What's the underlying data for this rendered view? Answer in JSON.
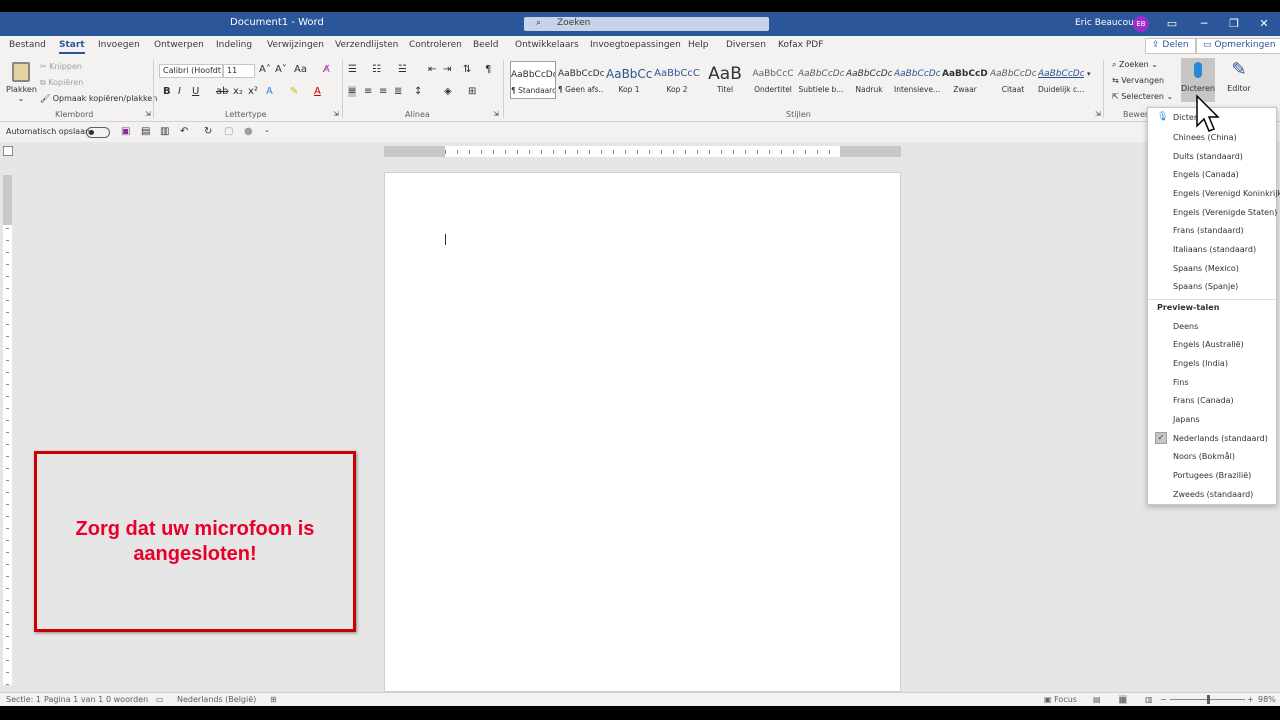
{
  "titlebar": {
    "title": "Document1  -  Word",
    "search_placeholder": "Zoeken",
    "user_name": "Eric Beaucourt",
    "user_initials": "EB",
    "min_glyph": "─",
    "max_glyph": "❐",
    "close_glyph": "✕"
  },
  "tabs": [
    "Bestand",
    "Start",
    "Invoegen",
    "Ontwerpen",
    "Indeling",
    "Verwijzingen",
    "Verzendlijsten",
    "Controleren",
    "Beeld",
    "Ontwikkelaars",
    "Invoegtoepassingen",
    "Help",
    "Diversen",
    "Kofax PDF"
  ],
  "tab_actions": {
    "share": "Delen",
    "comments": "Opmerkingen"
  },
  "ribbon": {
    "clipboard": {
      "paste": "Plakken",
      "cut": "Knippen",
      "copy": "Kopiëren",
      "format_painter": "Opmaak kopiëren/plakken",
      "label": "Klembord"
    },
    "font": {
      "font_name": "Calibri (Hoofdt",
      "font_size": "11",
      "label": "Lettertype"
    },
    "paragraph": {
      "label": "Alinea"
    },
    "styles": {
      "label": "Stijlen",
      "items": [
        {
          "preview": "AaBbCcDc",
          "name": "¶ Standaard"
        },
        {
          "preview": "AaBbCcDc",
          "name": "¶ Geen afs..."
        },
        {
          "preview": "AaBbCc",
          "name": "Kop 1"
        },
        {
          "preview": "AaBbCcC",
          "name": "Kop 2"
        },
        {
          "preview": "AaB",
          "name": "Titel"
        },
        {
          "preview": "AaBbCcC",
          "name": "Ondertitel"
        },
        {
          "preview": "AaBbCcDc",
          "name": "Subtiele b..."
        },
        {
          "preview": "AaBbCcDc",
          "name": "Nadruk"
        },
        {
          "preview": "AaBbCcDc",
          "name": "Intensieve..."
        },
        {
          "preview": "AaBbCcDc",
          "name": "Zwaar"
        },
        {
          "preview": "AaBbCcDc",
          "name": "Citaat"
        },
        {
          "preview": "AaBbCcDc",
          "name": "Duidelijk c..."
        }
      ]
    },
    "editing": {
      "find": "Zoeken",
      "replace": "Vervangen",
      "select": "Selecteren",
      "label": "Bewerk"
    },
    "dictate": "Dicteren",
    "editor": "Editor"
  },
  "qat": {
    "autosave": "Automatisch opslaan"
  },
  "callout": {
    "text": "Zorg dat uw microfoon is aangesloten!"
  },
  "dictate_menu": {
    "top_item": "Dicteren",
    "languages": [
      "Chinees (China)",
      "Duits (standaard)",
      "Engels (Canada)",
      "Engels (Verenigd Koninkrijk)",
      "Engels (Verenigde Staten)",
      "Frans (standaard)",
      "Italiaans (standaard)",
      "Spaans (Mexico)",
      "Spaans (Spanje)"
    ],
    "preview_heading": "Preview-talen",
    "preview_languages": [
      "Deens",
      "Engels (Australië)",
      "Engels (India)",
      "Fins",
      "Frans (Canada)",
      "Japans",
      "Nederlands (standaard)",
      "Noors (Bokmål)",
      "Portugees (Brazilië)",
      "Zweeds (standaard)"
    ],
    "checked": "Nederlands (standaard)"
  },
  "statusbar": {
    "section": "Sectie: 1",
    "page": "Pagina 1 van 1",
    "words": "0 woorden",
    "language": "Nederlands (België)",
    "focus": "Focus",
    "zoom": "98%"
  },
  "colors": {
    "accent": "#2b579a",
    "callout_border": "#cc0000",
    "callout_text": "#e8002a"
  }
}
